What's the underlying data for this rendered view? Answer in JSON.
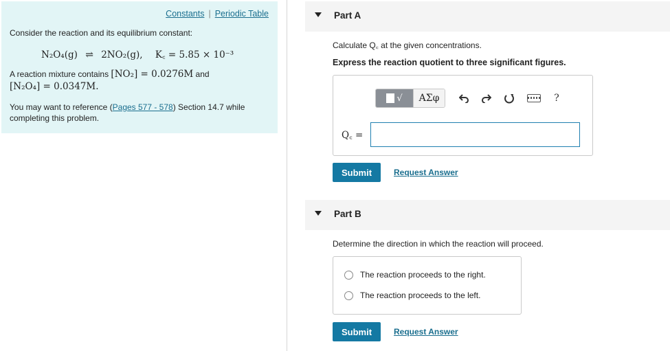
{
  "left_panel": {
    "links": {
      "constants": "Constants",
      "separator": "|",
      "periodic_table": "Periodic Table"
    },
    "intro": "Consider the reaction and its equilibrium constant:",
    "equation": {
      "reactant": "N₂O₄(g)",
      "arrow": "⇌",
      "product": "2NO₂(g),",
      "kc": "K꜀ = 5.85 × 10⁻³"
    },
    "mixture_text_1": "A reaction mixture contains",
    "mixture_no2": "[NO₂] = 0.0276M",
    "mixture_and": "and",
    "mixture_n2o4": "[N₂O₄] = 0.0347M.",
    "reference_prefix": "You may want to reference (",
    "reference_link": "Pages 577 - 578",
    "reference_suffix": ") Section 14.7 while",
    "reference_line2": "completing this problem."
  },
  "part_a": {
    "title": "Part A",
    "instruction": "Calculate Q꜀ at the given concentrations.",
    "express": "Express the reaction quotient to three significant figures.",
    "toolbar": {
      "templates_label": "√",
      "greek_label": "ΑΣφ",
      "help_label": "?"
    },
    "input_label": "Q꜀ =",
    "input_value": "",
    "submit_label": "Submit",
    "request_answer_label": "Request Answer"
  },
  "part_b": {
    "title": "Part B",
    "instruction": "Determine the direction in which the reaction will proceed.",
    "options": [
      "The reaction proceeds to the right.",
      "The reaction proceeds to the left."
    ],
    "submit_label": "Submit",
    "request_answer_label": "Request Answer"
  },
  "colors": {
    "panel_bg": "#e2f5f6",
    "link": "#1a6e8e",
    "submit_bg": "#1479a3",
    "input_border": "#1f7fb0"
  },
  "icons": [
    "caret-down-icon",
    "template-icon",
    "greek-icon",
    "undo-icon",
    "redo-icon",
    "reset-icon",
    "keyboard-icon",
    "help-icon"
  ]
}
